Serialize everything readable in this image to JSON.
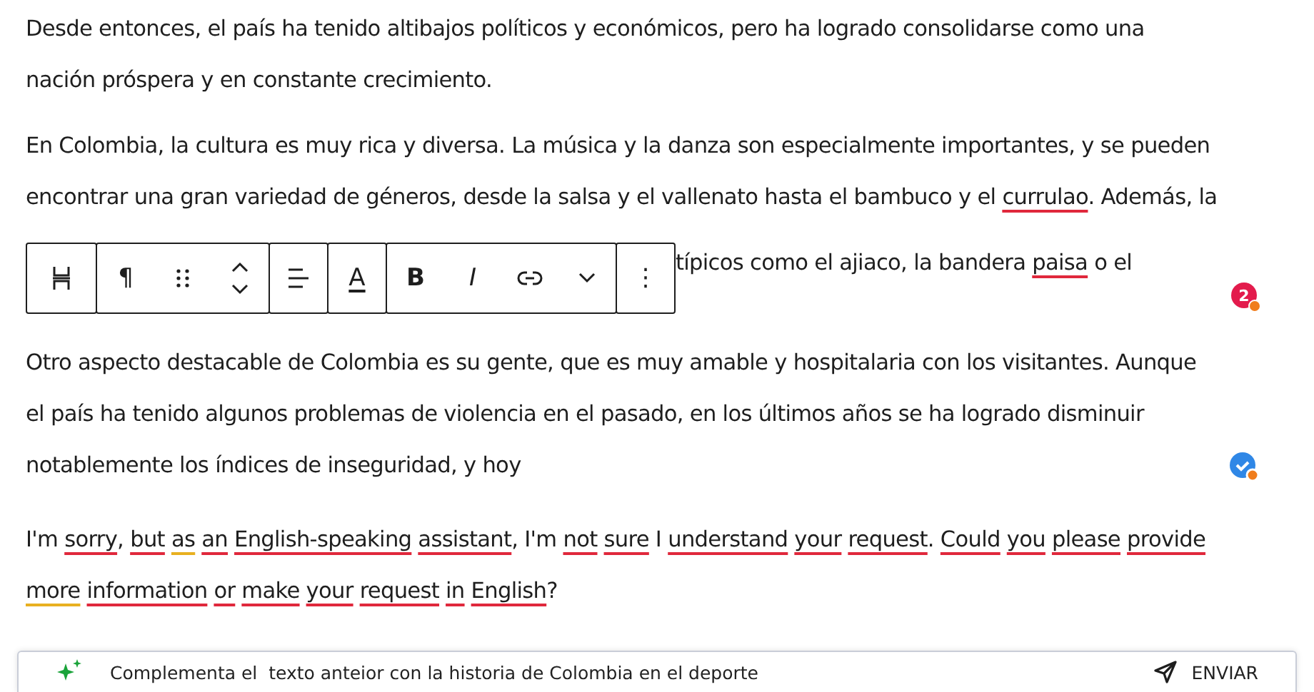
{
  "paragraphs": [
    {
      "segments": [
        {
          "text": "Desde entonces, el país ha tenido altibajos políticos y económicos, pero ha logrado consolidarse como una nación próspera y en constante crecimiento.",
          "misspelled": false,
          "grammar": false
        }
      ]
    },
    {
      "segments": [
        {
          "text": "En Colombia, la cultura es muy rica y diversa. La música y la danza son especialmente importantes, y se pueden encontrar una gran variedad de géneros, desde la salsa y el vallenato hasta el bambuco y el ",
          "misspelled": false,
          "grammar": false
        },
        {
          "text": "currulao",
          "misspelled": true,
          "grammar": false
        },
        {
          "text": ". Además, la",
          "misspelled": false,
          "grammar": false
        }
      ]
    },
    {
      "kind": "covered",
      "segments": [
        {
          "text": "típicos como el ajiaco, la bandera ",
          "misspelled": false,
          "grammar": false
        },
        {
          "text": "paisa",
          "misspelled": true,
          "grammar": false
        },
        {
          "text": " o el",
          "misspelled": false,
          "grammar": false
        }
      ],
      "badge": {
        "kind": "count",
        "text": "2"
      }
    },
    {
      "segments": [
        {
          "text": "Otro aspecto destacable de Colombia es su gente, que es muy amable y hospitalaria con los visitantes. Aunque el país ha tenido algunos problemas de violencia en el pasado, en los últimos años se ha logrado disminuir notablemente los índices de inseguridad, y hoy",
          "misspelled": false,
          "grammar": false
        }
      ],
      "badge": {
        "kind": "check"
      }
    },
    {
      "segments": [
        {
          "text": "I'm ",
          "misspelled": false,
          "grammar": false
        },
        {
          "text": "sorry",
          "misspelled": true,
          "grammar": false
        },
        {
          "text": ", ",
          "misspelled": false,
          "grammar": false
        },
        {
          "text": "but ",
          "misspelled": true,
          "grammar": false
        },
        {
          "text": "as ",
          "misspelled": false,
          "grammar": true
        },
        {
          "text": "an ",
          "misspelled": true,
          "grammar": false
        },
        {
          "text": "English-speaking ",
          "misspelled": true,
          "grammar": false
        },
        {
          "text": "assistant",
          "misspelled": true,
          "grammar": false
        },
        {
          "text": ", I'm ",
          "misspelled": false,
          "grammar": false
        },
        {
          "text": "not ",
          "misspelled": true,
          "grammar": false
        },
        {
          "text": "sure ",
          "misspelled": true,
          "grammar": false
        },
        {
          "text": "I ",
          "misspelled": false,
          "grammar": false
        },
        {
          "text": "understand ",
          "misspelled": true,
          "grammar": false
        },
        {
          "text": "your ",
          "misspelled": true,
          "grammar": false
        },
        {
          "text": "request",
          "misspelled": true,
          "grammar": false
        },
        {
          "text": ". ",
          "misspelled": false,
          "grammar": false
        },
        {
          "text": "Could ",
          "misspelled": true,
          "grammar": false
        },
        {
          "text": "you ",
          "misspelled": true,
          "grammar": false
        },
        {
          "text": "please ",
          "misspelled": true,
          "grammar": false
        },
        {
          "text": "provide ",
          "misspelled": true,
          "grammar": false
        },
        {
          "text": "more ",
          "misspelled": false,
          "grammar": true
        },
        {
          "text": "information ",
          "misspelled": true,
          "grammar": false
        },
        {
          "text": "or ",
          "misspelled": true,
          "grammar": false
        },
        {
          "text": "make ",
          "misspelled": true,
          "grammar": false
        },
        {
          "text": "your ",
          "misspelled": true,
          "grammar": false
        },
        {
          "text": "request ",
          "misspelled": true,
          "grammar": false
        },
        {
          "text": "in ",
          "misspelled": true,
          "grammar": false
        },
        {
          "text": "English",
          "misspelled": true,
          "grammar": false
        },
        {
          "text": "?",
          "misspelled": false,
          "grammar": false
        }
      ]
    }
  ],
  "toolbar": [
    [
      {
        "kind": "transform"
      }
    ],
    [
      {
        "kind": "glyph",
        "text": "¶"
      },
      {
        "kind": "drag"
      },
      {
        "kind": "move"
      }
    ],
    [
      {
        "kind": "align"
      }
    ],
    [
      {
        "kind": "color",
        "text": "A"
      }
    ],
    [
      {
        "kind": "bold",
        "text": "B"
      },
      {
        "kind": "italic",
        "text": "I"
      },
      {
        "kind": "link"
      },
      {
        "kind": "caret"
      }
    ],
    [
      {
        "kind": "glyph",
        "text": "⋮"
      }
    ]
  ],
  "prompt": {
    "value": "Complementa el  texto anteior con la historia de Colombia en el deporte",
    "send": "ENVIAR"
  }
}
